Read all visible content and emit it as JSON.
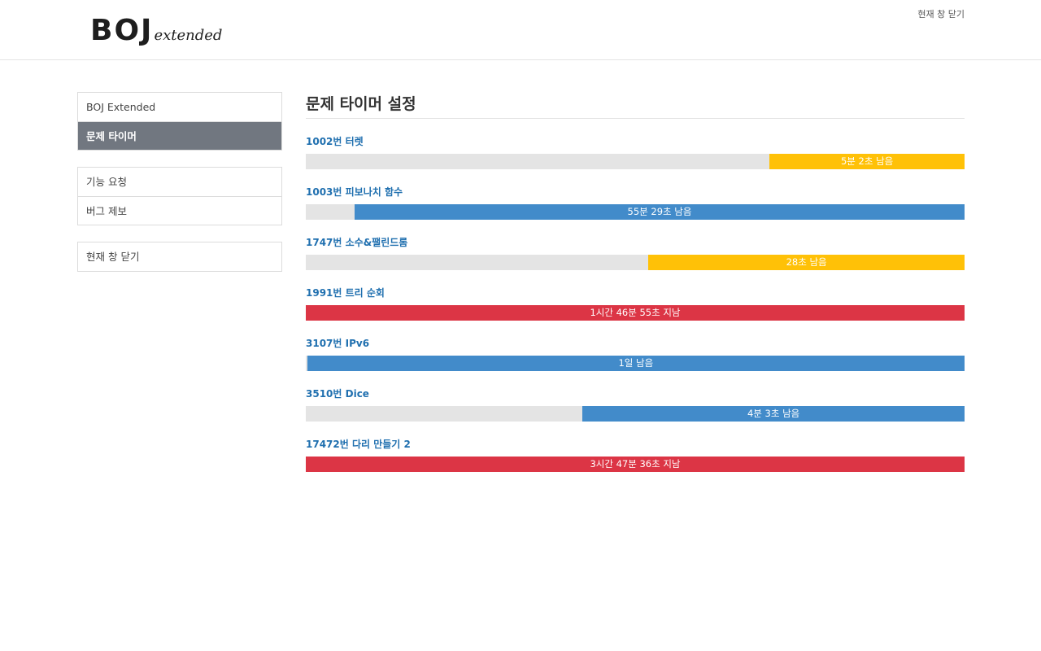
{
  "header": {
    "logo_main": "BOJ",
    "logo_sub": "extended",
    "close_label": "현재 창 닫기"
  },
  "sidebar": {
    "groups": [
      {
        "items": [
          {
            "label": "BOJ Extended",
            "active": false
          },
          {
            "label": "문제 타이머",
            "active": true
          }
        ]
      },
      {
        "items": [
          {
            "label": "기능 요청",
            "active": false
          },
          {
            "label": "버그 제보",
            "active": false
          }
        ]
      },
      {
        "items": [
          {
            "label": "현재 창 닫기",
            "active": false
          }
        ]
      }
    ]
  },
  "main": {
    "title": "문제 타이머 설정",
    "timers": [
      {
        "title": "1002번 터렛",
        "status": "5분 2초 남음",
        "fill_percent": 29.6,
        "color": "#ffc107"
      },
      {
        "title": "1003번 피보나치 함수",
        "status": "55분 29초 남음",
        "fill_percent": 92.6,
        "color": "#428bca"
      },
      {
        "title": "1747번 소수&팰린드롬",
        "status": "28초 남음",
        "fill_percent": 48.0,
        "color": "#ffc107"
      },
      {
        "title": "1991번 트리 순회",
        "status": "1시간 46분 55초 지남",
        "fill_percent": 100,
        "color": "#dc3545"
      },
      {
        "title": "3107번 IPv6",
        "status": "1일 남음",
        "fill_percent": 99.8,
        "color": "#428bca"
      },
      {
        "title": "3510번 Dice",
        "status": "4분 3초 남음",
        "fill_percent": 58.0,
        "color": "#428bca"
      },
      {
        "title": "17472번 다리 만들기 2",
        "status": "3시간 47분 36초 지남",
        "fill_percent": 100,
        "color": "#dc3545"
      }
    ]
  }
}
